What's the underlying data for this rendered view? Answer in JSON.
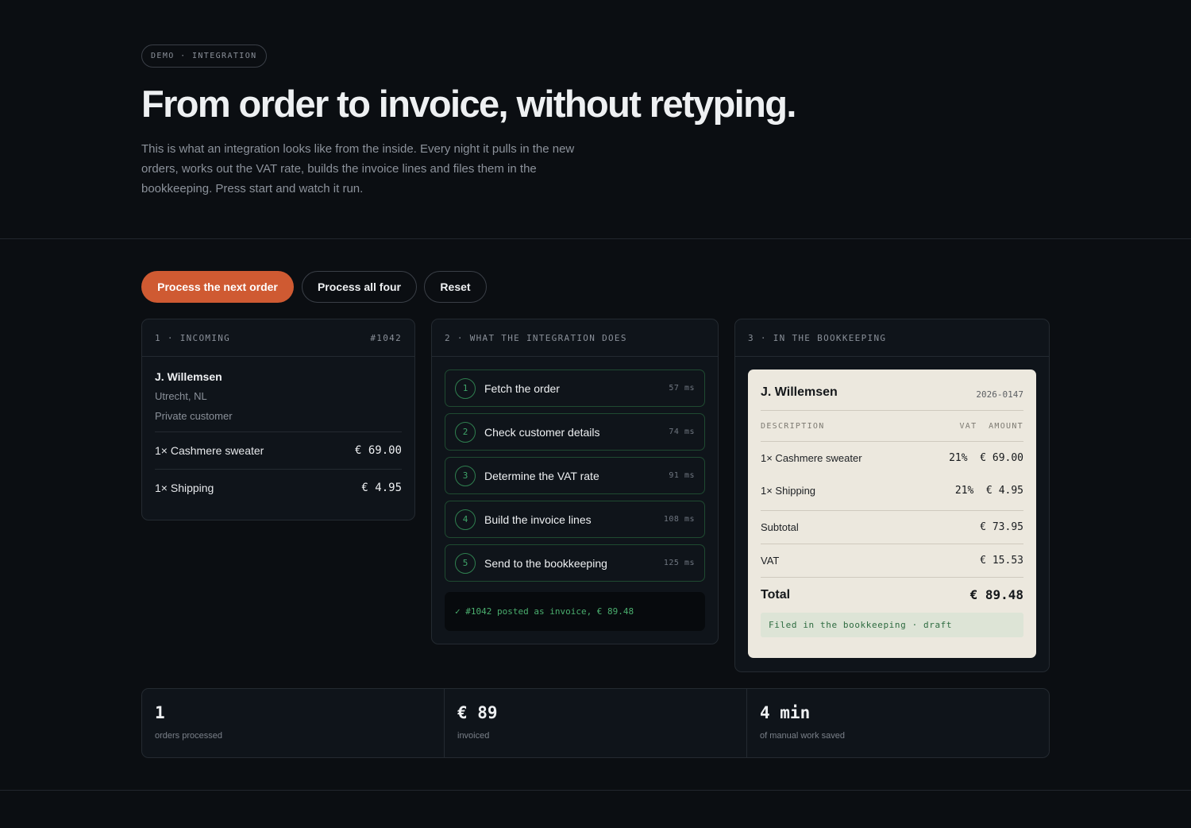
{
  "hero": {
    "badge": "DEMO · INTEGRATION",
    "title": "From order to invoice, without retyping.",
    "description": "This is what an integration looks like from the inside. Every night it pulls in the new orders, works out the VAT rate, builds the invoice lines and files them in the bookkeeping. Press start and watch it run."
  },
  "controls": {
    "process_next": "Process the next order",
    "process_all": "Process all four",
    "reset": "Reset"
  },
  "incoming": {
    "header": "1 · INCOMING",
    "order_id": "#1042",
    "customer_name": "J. Willemsen",
    "location": "Utrecht, NL",
    "customer_type": "Private customer",
    "lines": [
      {
        "description": "1× Cashmere sweater",
        "amount": "€ 69.00"
      },
      {
        "description": "1× Shipping",
        "amount": "€ 4.95"
      }
    ]
  },
  "integration": {
    "header": "2 · WHAT THE INTEGRATION DOES",
    "steps": [
      {
        "number": "1",
        "label": "Fetch the order",
        "duration": "57 ms"
      },
      {
        "number": "2",
        "label": "Check customer details",
        "duration": "74 ms"
      },
      {
        "number": "3",
        "label": "Determine the VAT rate",
        "duration": "91 ms"
      },
      {
        "number": "4",
        "label": "Build the invoice lines",
        "duration": "108 ms"
      },
      {
        "number": "5",
        "label": "Send to the bookkeeping",
        "duration": "125 ms"
      }
    ],
    "log": "✓ #1042 posted as invoice, € 89.48"
  },
  "bookkeeping": {
    "header": "3 · IN THE BOOKKEEPING",
    "invoice": {
      "customer_name": "J. Willemsen",
      "invoice_number": "2026-0147",
      "col_description": "DESCRIPTION",
      "col_vat": "VAT",
      "col_amount": "AMOUNT",
      "lines": [
        {
          "description": "1× Cashmere sweater",
          "vat_amount": "21%  € 69.00"
        },
        {
          "description": "1× Shipping",
          "vat_amount": "21%  € 4.95"
        }
      ],
      "subtotal_label": "Subtotal",
      "subtotal": "€ 73.95",
      "vat_label": "VAT",
      "vat": "€ 15.53",
      "total_label": "Total",
      "total": "€ 89.48",
      "status": "Filed in the bookkeeping · draft"
    }
  },
  "stats": [
    {
      "value": "1",
      "label": "orders processed"
    },
    {
      "value": "€ 89",
      "label": "invoiced"
    },
    {
      "value": "4 min",
      "label": "of manual work saved"
    }
  ],
  "colors": {
    "background": "#0b0e12",
    "accent": "#cf5a32",
    "success": "#3fa56a",
    "invoice_paper": "#ece8de"
  }
}
